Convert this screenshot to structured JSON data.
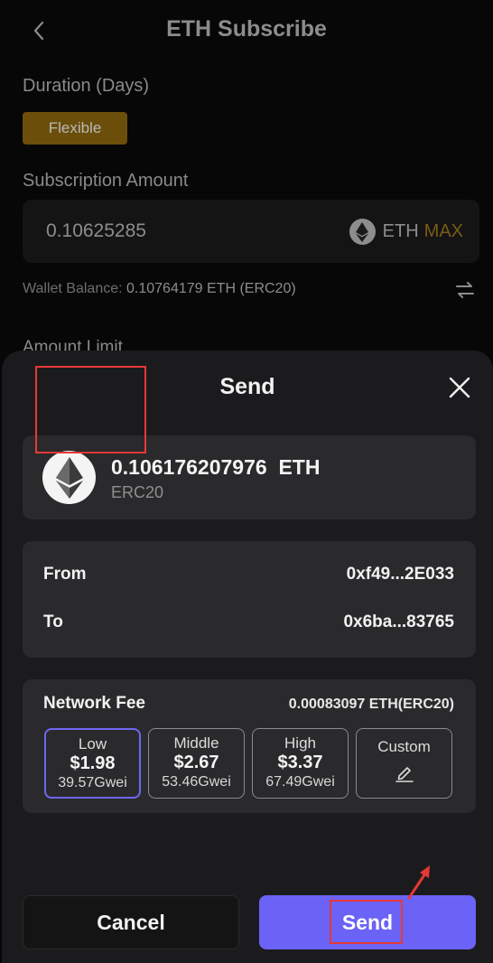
{
  "header": {
    "title": "ETH Subscribe",
    "back_icon": "chevron-left-icon"
  },
  "duration": {
    "label": "Duration (Days)",
    "option": "Flexible"
  },
  "subscription": {
    "label": "Subscription Amount",
    "value": "0.10625285",
    "currency": "ETH",
    "max_label": "MAX"
  },
  "wallet": {
    "prefix": "Wallet Balance: ",
    "value": "0.10764179 ETH (ERC20)"
  },
  "amount_limit": {
    "label": "Amount Limit"
  },
  "sheet": {
    "title": "Send",
    "token_amount": "0.106176207976  ETH",
    "token_network": "ERC20",
    "from_label": "From",
    "from_value": "0xf49...2E033",
    "to_label": "To",
    "to_value": "0x6ba...83765",
    "fee_label": "Network Fee",
    "fee_total": "0.00083097 ETH(ERC20)",
    "fee_options": [
      {
        "name": "Low",
        "usd": "$1.98",
        "gwei": "39.57Gwei",
        "selected": true
      },
      {
        "name": "Middle",
        "usd": "$2.67",
        "gwei": "53.46Gwei",
        "selected": false
      },
      {
        "name": "High",
        "usd": "$3.37",
        "gwei": "67.49Gwei",
        "selected": false
      },
      {
        "name": "Custom",
        "icon": "edit-icon",
        "selected": false
      }
    ],
    "cancel_label": "Cancel",
    "send_label": "Send"
  },
  "colors": {
    "accent": "#6b63f6",
    "selected_border": "#6f67f0",
    "gold": "#6b4e0a",
    "annotation": "#e53935"
  }
}
